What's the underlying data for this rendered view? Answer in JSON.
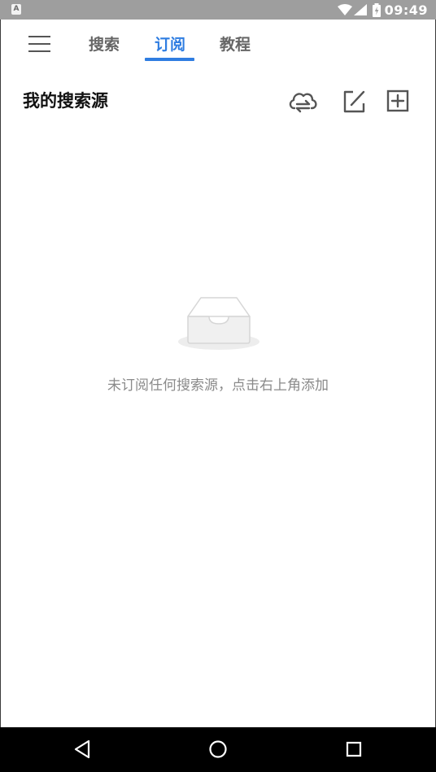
{
  "status_bar": {
    "time": "09:49",
    "notification_badge": "A",
    "icons": [
      "wifi-icon",
      "signal-icon",
      "battery-icon"
    ]
  },
  "header": {
    "menu_icon": "menu-icon",
    "tabs": [
      {
        "label": "搜索",
        "active": false
      },
      {
        "label": "订阅",
        "active": true
      },
      {
        "label": "教程",
        "active": false
      }
    ],
    "active_color": "#2f7de1"
  },
  "section": {
    "title": "我的搜索源",
    "actions": [
      "cloud-sync-icon",
      "edit-icon",
      "add-icon"
    ]
  },
  "empty_state": {
    "icon": "empty-inbox-icon",
    "message": "未订阅任何搜索源，点击右上角添加"
  },
  "nav_bar": {
    "buttons": [
      "back-icon",
      "home-icon",
      "recents-icon"
    ]
  }
}
